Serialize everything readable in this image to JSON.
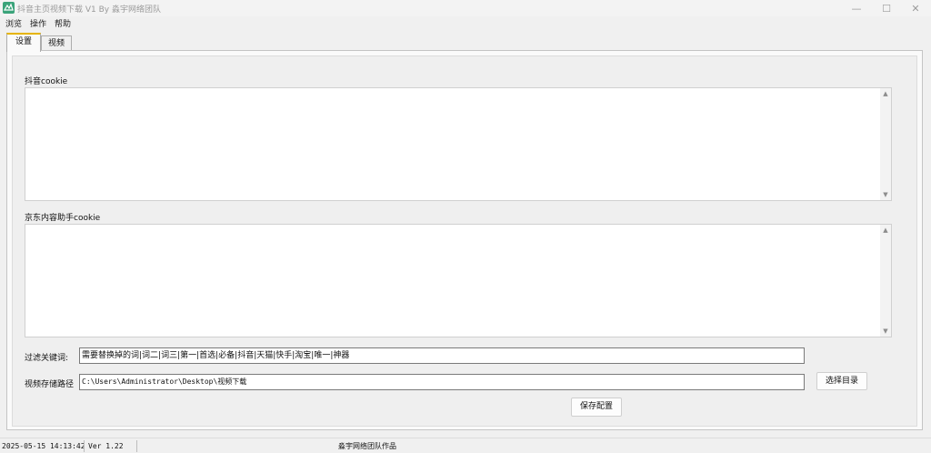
{
  "window": {
    "title": "抖音主页视频下载 V1 By 淼宇网络团队",
    "controls": {
      "minimize": "—",
      "maximize": "☐",
      "close": "✕"
    }
  },
  "menu": {
    "items": [
      "浏览",
      "操作",
      "帮助"
    ]
  },
  "tabs": [
    {
      "label": "设置",
      "active": true
    },
    {
      "label": "视频",
      "active": false
    }
  ],
  "settings": {
    "douyin_cookie_label": "抖音cookie",
    "douyin_cookie_value": "",
    "jd_cookie_label": "京东内容助手cookie",
    "jd_cookie_value": "",
    "filter_label": "过滤关键词:",
    "filter_value": "需要替换掉的词|词二|词三|第一|首选|必备|抖音|天猫|快手|淘宝|唯一|神器",
    "save_path_label": "视频存储路径",
    "save_path_value": "C:\\Users\\Administrator\\Desktop\\视频下载",
    "choose_dir_button": "选择目录",
    "save_config_button": "保存配置"
  },
  "status": {
    "datetime": "2025-05-15 14:13:42",
    "version": "Ver 1.22",
    "credit": "淼宇网络团队作品"
  },
  "icons": {
    "app": "app-logo-icon",
    "scroll_up": "scroll-up-arrow-icon",
    "scroll_down": "scroll-down-arrow-icon"
  },
  "colors": {
    "active_tab_accent": "#e6b400",
    "app_icon": "#3aa37a"
  }
}
